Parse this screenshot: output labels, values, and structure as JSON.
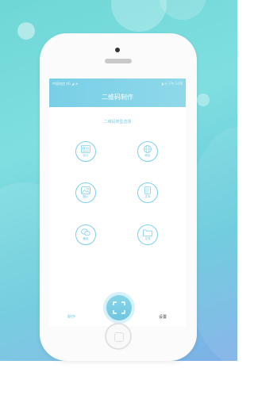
{
  "status_bar": {
    "left": "中国电信 4G ◢ ◔",
    "right": "▮ ◔ 下午 2:56"
  },
  "header": {
    "title": "二维码制作"
  },
  "subtitle": "二维码类型选择",
  "types": [
    {
      "label": "名片",
      "icon": "card-icon"
    },
    {
      "label": "网址",
      "icon": "globe-icon"
    },
    {
      "label": "图片",
      "icon": "image-icon"
    },
    {
      "label": "文本",
      "icon": "document-icon"
    },
    {
      "label": "微信",
      "icon": "wechat-icon"
    },
    {
      "label": "文件",
      "icon": "folder-icon"
    }
  ],
  "bottom_nav": {
    "make": "制作",
    "settings": "设置"
  },
  "colors": {
    "accent": "#79cfe6",
    "background_top": "#6fd6d6",
    "background_bottom": "#7fb0e8"
  }
}
